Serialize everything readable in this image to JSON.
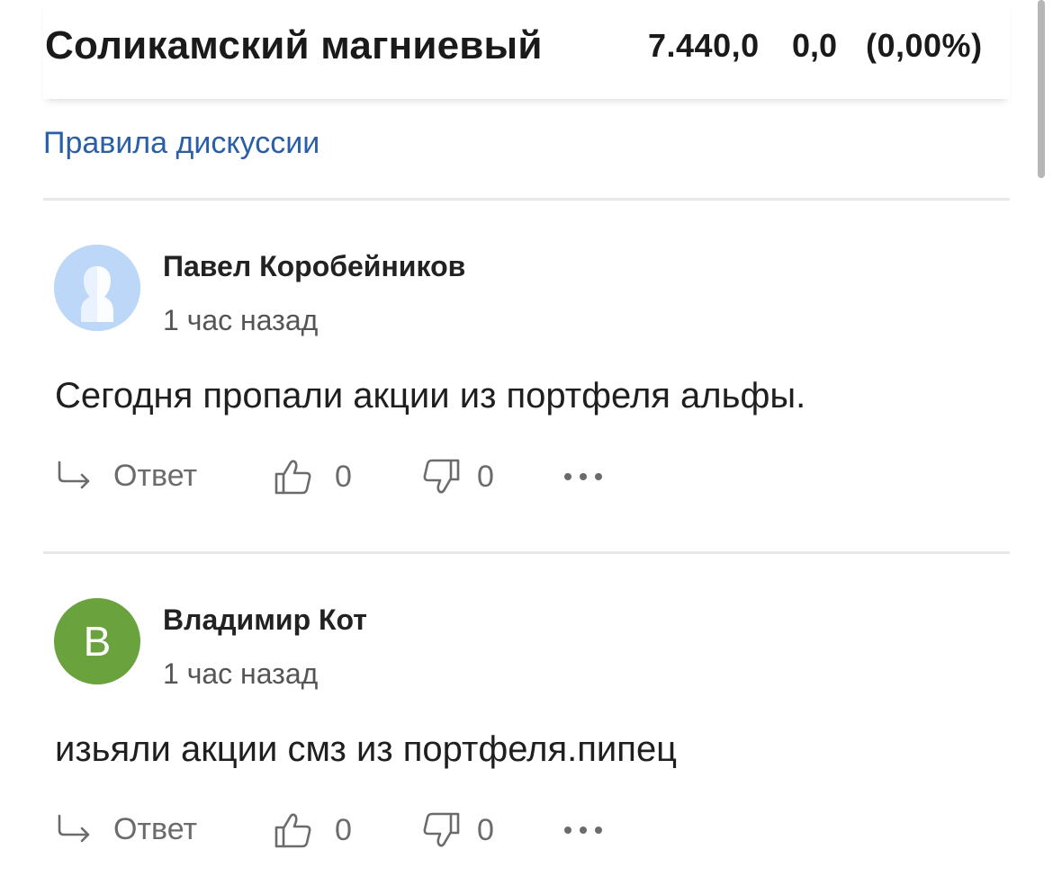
{
  "header": {
    "company": "Соликамский магниевый",
    "price": "7.440,0",
    "change": "0,0",
    "change_pct": "(0,00%)"
  },
  "rules_link": "Правила дискуссии",
  "comments": [
    {
      "author": "Павел Коробейников",
      "avatar": "default-user-icon",
      "time": "1 час назад",
      "text": "Сегодня пропали акции из портфеля альфы.",
      "reply_label": "Ответ",
      "likes": "0",
      "dislikes": "0"
    },
    {
      "author": "Владимир Кот",
      "avatar_letter": "В",
      "avatar_color": "#6aa23d",
      "time": "1 час назад",
      "text": "изьяли акции смз из портфеля.пипец",
      "reply_label": "Ответ",
      "likes": "0",
      "dislikes": "0"
    }
  ],
  "colors": {
    "link": "#285fa8",
    "text": "#222222",
    "muted": "#6b6b6b"
  }
}
